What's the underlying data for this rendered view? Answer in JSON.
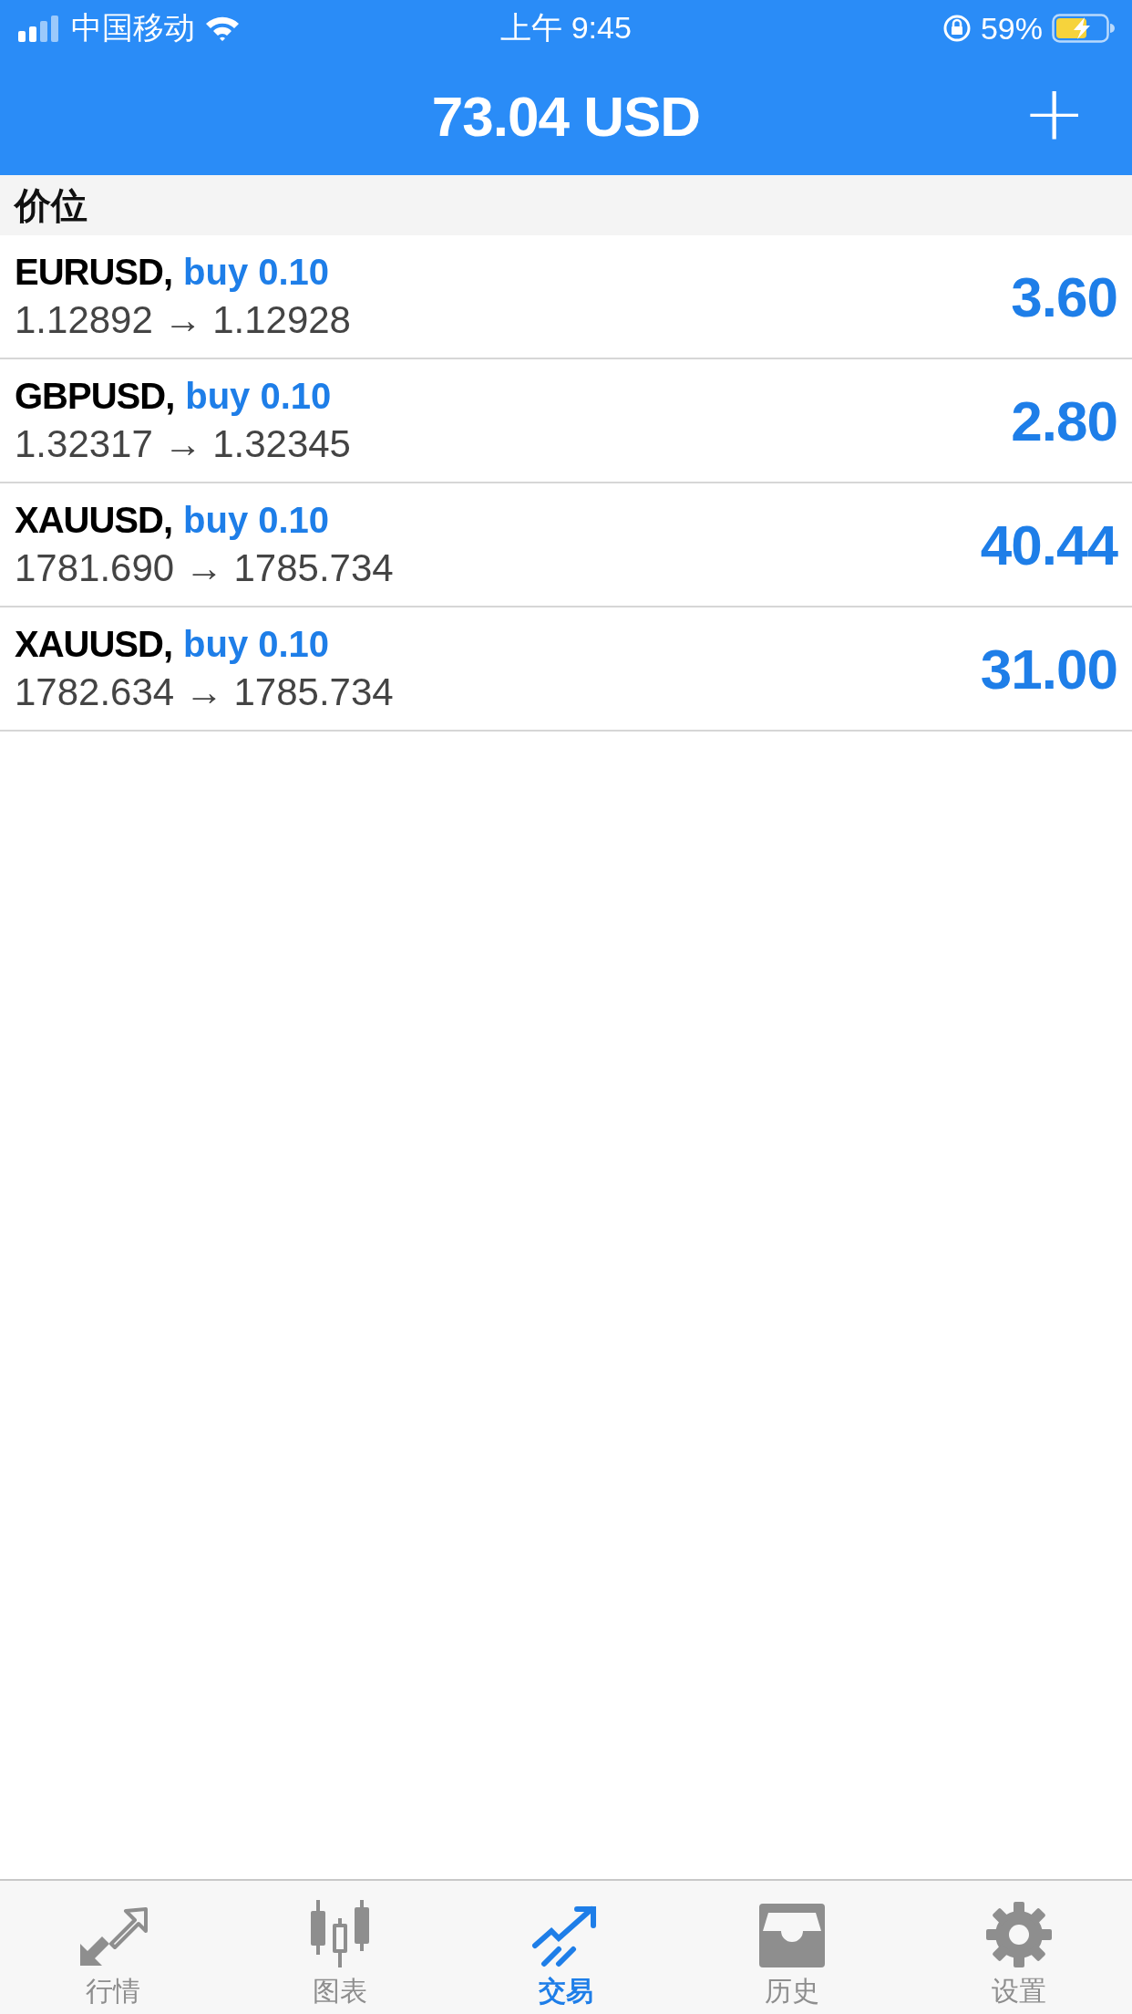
{
  "status_bar": {
    "carrier": "中国移动",
    "time": "上午 9:45",
    "battery": "59%"
  },
  "header": {
    "title": "73.04 USD",
    "add_button": "+"
  },
  "section": {
    "title": "价位"
  },
  "positions": [
    {
      "symbol": "EURUSD,",
      "order": "buy 0.10",
      "prices": "1.12892 → 1.12928",
      "profit": "3.60"
    },
    {
      "symbol": "GBPUSD,",
      "order": "buy 0.10",
      "prices": "1.32317 → 1.32345",
      "profit": "2.80"
    },
    {
      "symbol": "XAUUSD,",
      "order": "buy 0.10",
      "prices": "1781.690 → 1785.734",
      "profit": "40.44"
    },
    {
      "symbol": "XAUUSD,",
      "order": "buy 0.10",
      "prices": "1782.634 → 1785.734",
      "profit": "31.00"
    }
  ],
  "tabs": [
    {
      "label": "行情",
      "selected": false
    },
    {
      "label": "图表",
      "selected": false
    },
    {
      "label": "交易",
      "selected": true
    },
    {
      "label": "历史",
      "selected": false
    },
    {
      "label": "设置",
      "selected": false
    }
  ]
}
